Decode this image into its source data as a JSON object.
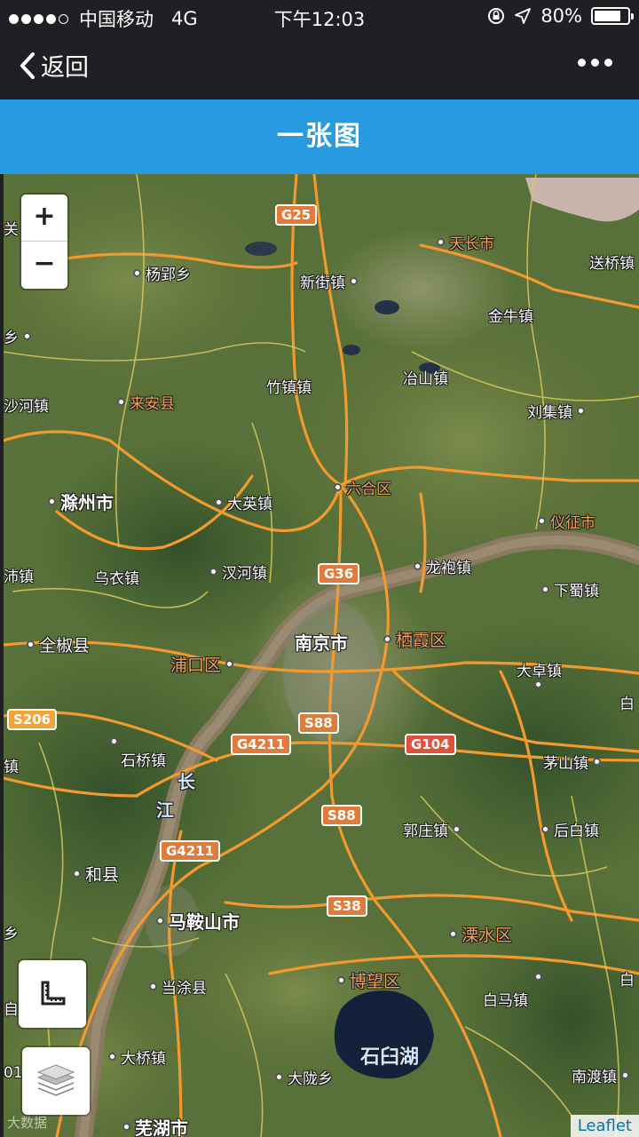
{
  "status_bar": {
    "carrier": "中国移动",
    "network": "4G",
    "time": "下午12:03",
    "battery": "80%",
    "battery_level": 0.8
  },
  "nav": {
    "back_label": "返回"
  },
  "title": "一张图",
  "map": {
    "zoom_in": "+",
    "zoom_out": "−",
    "attribution": "Leaflet",
    "watermark": "大数据",
    "places": {
      "tianchang": "天长市",
      "songqiao": "送桥镇",
      "yangying": "杨郢乡",
      "xinjie": "新街镇",
      "jinniu": "金牛镇",
      "zhuzhen": "竹镇镇",
      "yeshan": "冶山镇",
      "laian": "来安县",
      "liuji": "刘集镇",
      "shahe": "沙河镇",
      "chuzhou": "滁州市",
      "daying": "大英镇",
      "luhe": "六合区",
      "yizheng": "仪征市",
      "zhahe": "沛镇",
      "wuyi": "乌衣镇",
      "tanghe": "汊河镇",
      "longpao": "龙袍镇",
      "xiashu": "下蜀镇",
      "quanjiao": "全椒县",
      "pukou": "浦口区",
      "nanjing": "南京市",
      "qixia": "栖霞区",
      "dazhuo": "大卓镇",
      "shiqiao": "石桥镇",
      "maoshan": "茅山镇",
      "guozhuang": "郭庄镇",
      "houbai": "后白镇",
      "hexian": "和县",
      "maanshan": "马鞍山市",
      "lishui": "溧水区",
      "dangtu": "当涂县",
      "bowang": "博望区",
      "baima": "白马镇",
      "daqiao": "大桥镇",
      "dalong": "大陇乡",
      "nandu": "南渡镇",
      "wuhu": "芜湖市",
      "river_chang": "长",
      "river_jiang": "江",
      "shijiu_lake": "石臼湖",
      "edge_guan": "关",
      "edge_xiang": "乡",
      "edge_zhen": "镇",
      "edge_xiang2": "乡",
      "edge_bai": "白",
      "edge_bai2": "白",
      "edge_01": "01",
      "edge_dai": "自"
    },
    "roads": {
      "g25": "G25",
      "g36": "G36",
      "s88a": "S88",
      "s88b": "S88",
      "g4211a": "G4211",
      "g4211b": "G4211",
      "g104": "G104",
      "s206": "S206",
      "s38": "S38"
    }
  }
}
